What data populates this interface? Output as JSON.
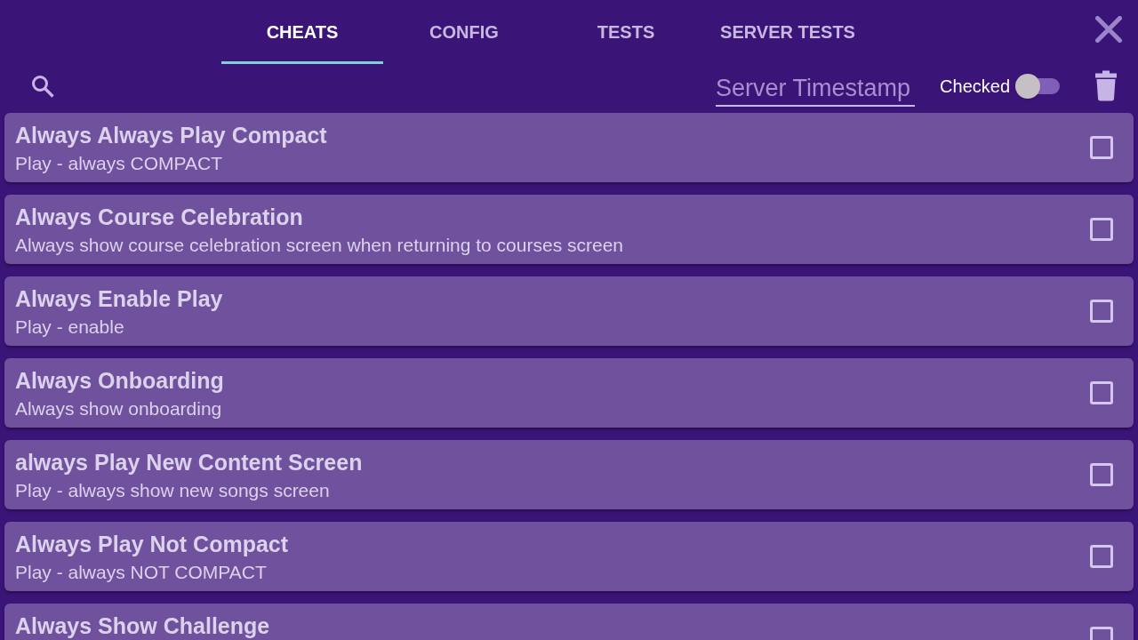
{
  "tabs": [
    {
      "label": "CHEATS",
      "selected": true
    },
    {
      "label": "CONFIG",
      "selected": false
    },
    {
      "label": "TESTS",
      "selected": false
    },
    {
      "label": "SERVER TESTS",
      "selected": false
    }
  ],
  "search": {
    "placeholder": "Server Timestamp"
  },
  "checked_filter": {
    "label": "Checked",
    "on": false
  },
  "cheats": [
    {
      "title": "Always Always Play Compact",
      "description": "Play - always COMPACT",
      "checked": false
    },
    {
      "title": "Always Course Celebration",
      "description": "Always show course celebration screen when returning to courses screen",
      "checked": false
    },
    {
      "title": "Always Enable Play",
      "description": "Play - enable",
      "checked": false
    },
    {
      "title": "Always Onboarding",
      "description": "Always show onboarding",
      "checked": false
    },
    {
      "title": "always Play New Content Screen",
      "description": "Play - always show new songs screen",
      "checked": false
    },
    {
      "title": "Always Play Not Compact",
      "description": "Play - always NOT COMPACT",
      "checked": false
    },
    {
      "title": "Always Show Challenge",
      "checked": false
    }
  ]
}
